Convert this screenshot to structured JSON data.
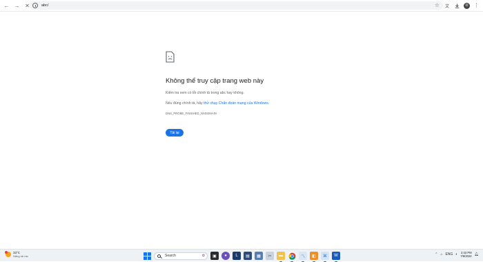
{
  "browser": {
    "url": "abc/",
    "nav": {
      "back": "←",
      "forward": "→",
      "reload": "✕"
    }
  },
  "error": {
    "title": "Không thể truy cập trang web này",
    "line1": "Kiểm tra xem có lỗi chính tả trong abc hay không.",
    "line2_prefix": "Nếu đúng chính tả, hãy ",
    "line2_link": "thử chạy Chẩn đoán mạng của Windows",
    "line2_suffix": ".",
    "code": "DNS_PROBE_FINISHED_NXDOMAIN",
    "reload_label": "Tải lại"
  },
  "taskbar": {
    "weather_temp": "33°C",
    "weather_condition": "Nắng rải rác",
    "search_label": "Search",
    "language": "ENG",
    "time": "2:43 PM",
    "date": "7/8/2024"
  },
  "colors": {
    "accent": "#1a73e8",
    "link": "#1a73e8"
  }
}
